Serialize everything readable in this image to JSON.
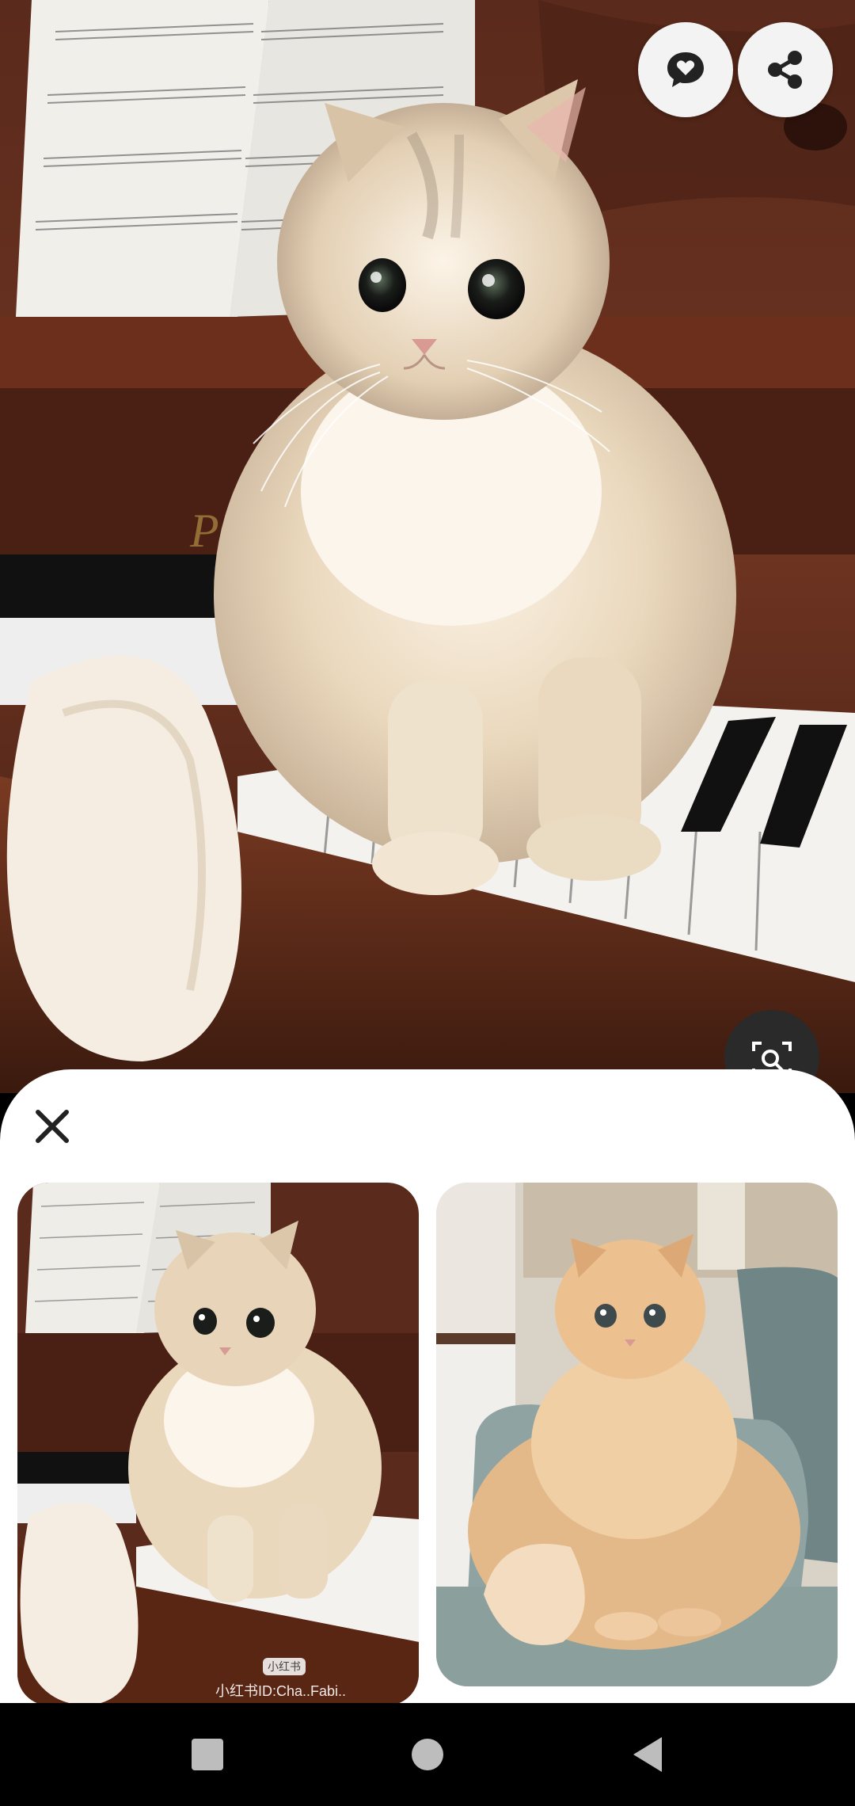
{
  "icons": {
    "comment": "chat-bubble-heart-icon",
    "share": "share-icon",
    "lens": "lens-search-icon",
    "close": "close-icon",
    "recents": "square-icon",
    "home": "circle-icon",
    "back": "triangle-back-icon"
  },
  "sheet": {
    "results": [
      {
        "subject": "cream long-haired kitten sitting on piano keys",
        "watermark_badge": "小红书",
        "watermark_text": "小红书ID:Cha..Fabi.."
      },
      {
        "subject": "orange long-haired kitten sitting on a chair"
      }
    ]
  },
  "colors": {
    "sheet_bg": "#ffffff",
    "fab_bg": "#f3f3f3",
    "nav_bg": "#000000",
    "icon_dark": "#222222",
    "nav_icon": "#bdbdbd"
  }
}
